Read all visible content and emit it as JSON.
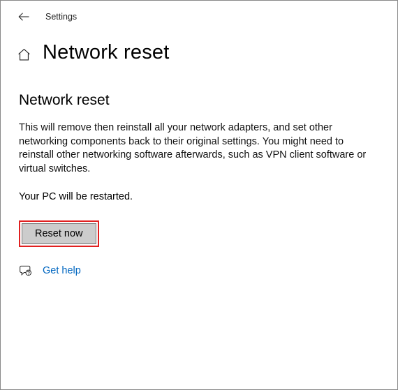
{
  "titlebar": {
    "label": "Settings"
  },
  "header": {
    "title": "Network reset"
  },
  "section": {
    "heading": "Network reset",
    "description": "This will remove then reinstall all your network adapters, and set other networking components back to their original settings. You might need to reinstall other networking software afterwards, such as VPN client software or virtual switches.",
    "restart_note": "Your PC will be restarted."
  },
  "actions": {
    "reset_label": "Reset now"
  },
  "help": {
    "link_label": "Get help"
  }
}
